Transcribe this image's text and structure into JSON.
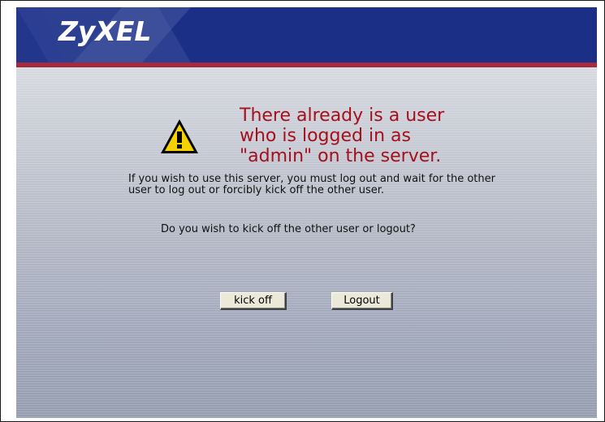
{
  "header": {
    "logo_text": "ZyXEL",
    "bar_color": "#1b2f86",
    "accent_rule_color": "#a52a3f"
  },
  "warning": {
    "icon": "warning-triangle-icon",
    "headline_lines": [
      "There already is a user",
      "who is logged in as",
      "\"admin\" on the server."
    ],
    "headline_color": "#a4101c"
  },
  "message": {
    "body": "If you wish to use this server, you must log out and wait for the other user to log out or forcibly kick off the other user.",
    "question": "Do you wish to kick off the other user or logout?"
  },
  "actions": {
    "kick_off_label": "kick off",
    "logout_label": "Logout"
  }
}
